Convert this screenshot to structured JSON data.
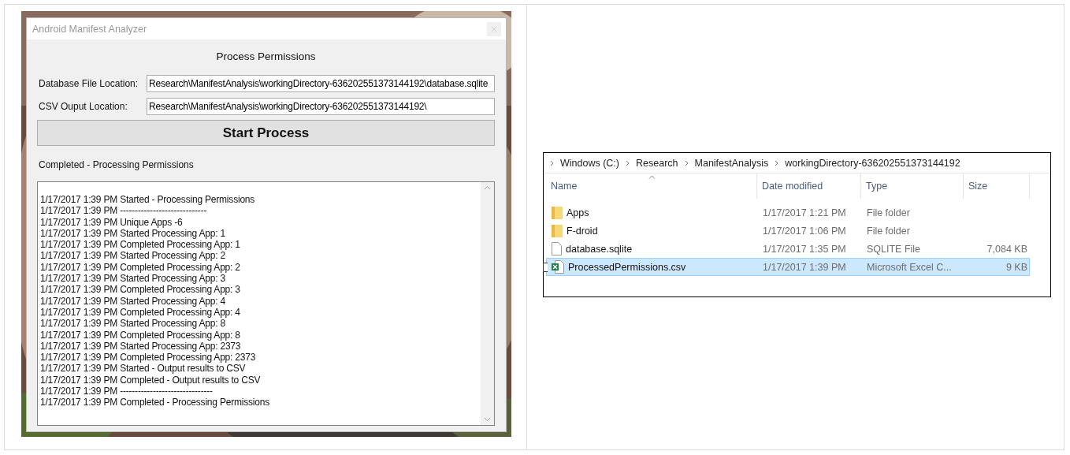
{
  "app_window": {
    "title": "Android Manifest Analyzer",
    "heading": "Process Permissions",
    "fields": [
      {
        "label": "Database File Location:",
        "value": "Research\\ManifestAnalysis\\workingDirectory-636202551373144192\\database.sqlite"
      },
      {
        "label": "CSV Ouput Location:",
        "value": "Research\\ManifestAnalysis\\workingDirectory-636202551373144192\\"
      }
    ],
    "button": "Start Process",
    "status": "Completed - Processing Permissions",
    "log": [
      "1/17/2017 1:39 PM Started - Processing Permissions",
      "1/17/2017 1:39 PM -----------------------------",
      "1/17/2017 1:39 PM Unique Apps -6",
      "1/17/2017 1:39 PM Started Processing App: 1",
      "1/17/2017 1:39 PM Completed Processing App: 1",
      "1/17/2017 1:39 PM Started Processing App: 2",
      "1/17/2017 1:39 PM Completed Processing App: 2",
      "1/17/2017 1:39 PM Started Processing App: 3",
      "1/17/2017 1:39 PM Completed Processing App: 3",
      "1/17/2017 1:39 PM Started Processing App: 4",
      "1/17/2017 1:39 PM Completed Processing App: 4",
      "1/17/2017 1:39 PM Started Processing App: 8",
      "1/17/2017 1:39 PM Completed Processing App: 8",
      "1/17/2017 1:39 PM Started Processing App: 2373",
      "1/17/2017 1:39 PM Completed Processing App: 2373",
      "1/17/2017 1:39 PM Started - Output results to CSV",
      "1/17/2017 1:39 PM Completed - Output results to CSV",
      "1/17/2017 1:39 PM -------------------------------",
      "1/17/2017 1:39 PM Completed - Processing Permissions"
    ]
  },
  "explorer": {
    "breadcrumb": [
      "Windows (C:)",
      "Research",
      "ManifestAnalysis",
      "workingDirectory-636202551373144192"
    ],
    "columns": [
      {
        "label": "Name",
        "sorted": true
      },
      {
        "label": "Date modified",
        "sorted": false
      },
      {
        "label": "Type",
        "sorted": false
      },
      {
        "label": "Size",
        "sorted": false
      }
    ],
    "rows": [
      {
        "kind": "folder",
        "name": "Apps",
        "date": "1/17/2017 1:21 PM",
        "type": "File folder",
        "selected": false
      },
      {
        "kind": "folder",
        "name": "F-droid",
        "date": "1/17/2017 1:06 PM",
        "type": "File folder",
        "selected": false
      },
      {
        "kind": "file",
        "name": "database.sqlite",
        "date": "1/17/2017 1:35 PM",
        "type": "SQLITE File",
        "size": "7,084 KB",
        "selected": false
      },
      {
        "kind": "excel",
        "name": "ProcessedPermissions.csv",
        "date": "1/17/2017 1:39 PM",
        "type": "Microsoft Excel C...",
        "size": "9 KB",
        "selected": true
      }
    ]
  }
}
